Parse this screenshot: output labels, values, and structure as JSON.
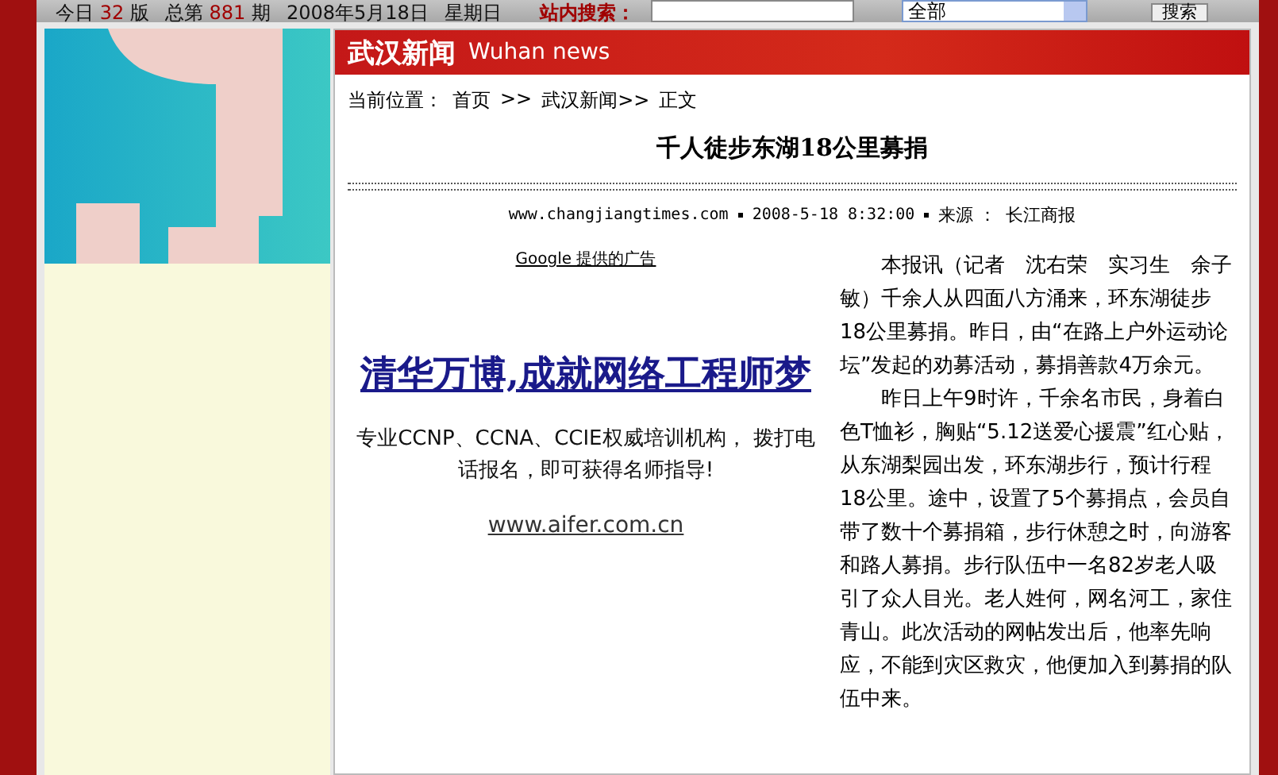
{
  "top_bar": {
    "issue_prefix": "今日",
    "issue_page": "32",
    "issue_page_suffix": "版",
    "total_prefix": "总第",
    "total_number": "881",
    "total_suffix": "期",
    "date": "2008年5月18日",
    "weekday": "星期日",
    "search_label": "站内搜索：",
    "search_scope": "全部",
    "search_button": "搜索"
  },
  "section": {
    "title": "武汉新闻",
    "subtitle": "Wuhan news"
  },
  "breadcrumb": {
    "label": "当前位置：",
    "items": [
      "首页",
      ">>",
      "武汉新闻>>",
      "正文"
    ]
  },
  "article": {
    "title": "千人徒步东湖18公里募捐",
    "meta": {
      "site": "www.changjiangtimes.com",
      "time": "2008-5-18 8:32:00",
      "source_label": "来源 ：",
      "source": "长江商报"
    },
    "ad": {
      "provider": "Google 提供的广告",
      "headline": "清华万博,成就网络工程师梦",
      "description": "专业CCNP、CCNA、CCIE权威培训机构， 拨打电话报名，即可获得名师指导!",
      "url": "www.aifer.com.cn"
    },
    "paragraphs": [
      "本报讯（记者　沈右荣　实习生　余子敏）千余人从四面八方涌来，环东湖徒步18公里募捐。昨日，由“在路上户外运动论坛”发起的劝募活动，募捐善款4万余元。",
      "昨日上午9时许，千余名市民，身着白色T恤衫，胸贴“5.12送爱心援震”红心贴，从东湖梨园出发，环东湖步行，预计行程18公里。途中，设置了5个募捐点，会员自带了数十个募捐箱，步行休憩之时，向游客和路人募捐。步行队伍中一名82岁老人吸引了众人目光。老人姓何，网名河工，家住青山。此次活动的网帖发出后，他率先响应，不能到灾区救灾，他便加入到募捐的队伍中来。"
    ]
  }
}
